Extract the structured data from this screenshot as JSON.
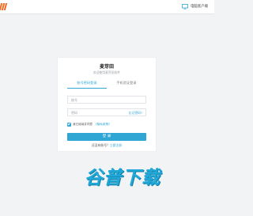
{
  "header": {
    "logo_text": "田",
    "client_label": "电脑客户端"
  },
  "login": {
    "title": "麦芽田",
    "subtitle": "欢迎使用麦芽田软件",
    "tabs": [
      {
        "label": "账号密码登录",
        "active": true
      },
      {
        "label": "手机验证登录",
        "active": false
      }
    ],
    "account_placeholder": "账号",
    "password_placeholder": "密码",
    "forgot_label": "忘记密码?",
    "agree_text": "我已阅读并同意",
    "agreement_link": "《隐私政策》",
    "agreed": true,
    "login_button": "登 录",
    "register_question": "还没有账号？",
    "register_link": "立即注册"
  },
  "watermark": "谷普下载",
  "colors": {
    "accent": "#2fa6d4",
    "logo": "#f06a20",
    "background": "#f2f3f5"
  }
}
